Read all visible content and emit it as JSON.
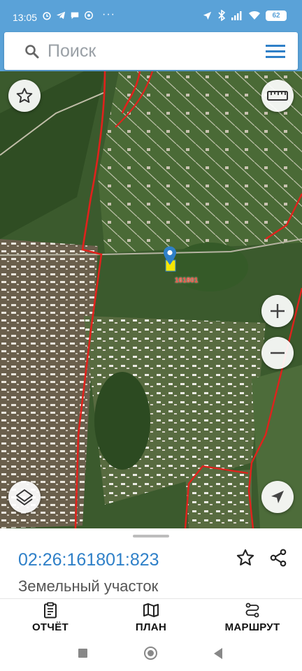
{
  "status_bar": {
    "time": "13:05",
    "battery": "62",
    "left_icons": [
      "alarm-icon",
      "telegram-icon",
      "chat-icon",
      "vpn-icon"
    ],
    "overflow": "···",
    "right_icons": [
      "navigation-icon",
      "bluetooth-icon",
      "signal-icon",
      "wifi-icon",
      "battery-icon"
    ]
  },
  "search": {
    "placeholder": "Поиск",
    "icons": [
      "search-icon",
      "hamburger-menu-icon"
    ]
  },
  "map": {
    "parcel_label": "161801",
    "controls": [
      "favorite-star-icon",
      "ruler-icon",
      "zoom-in-icon",
      "zoom-out-icon",
      "layers-icon",
      "locate-icon"
    ],
    "colors": {
      "boundary": "#e0221c",
      "pin": "#2f80c8",
      "parcel": "#f6e800"
    }
  },
  "sheet": {
    "cadastral_number": "02:26:161801:823",
    "parcel_type": "Земельный участок"
  },
  "actions": [
    {
      "label": "ОТЧЁТ",
      "icon": "clipboard-icon"
    },
    {
      "label": "ПЛАН",
      "icon": "map-icon"
    },
    {
      "label": "МАРШРУТ",
      "icon": "route-icon"
    }
  ],
  "colors": {
    "accent": "#5aa2d8",
    "link": "#2f80c8"
  }
}
